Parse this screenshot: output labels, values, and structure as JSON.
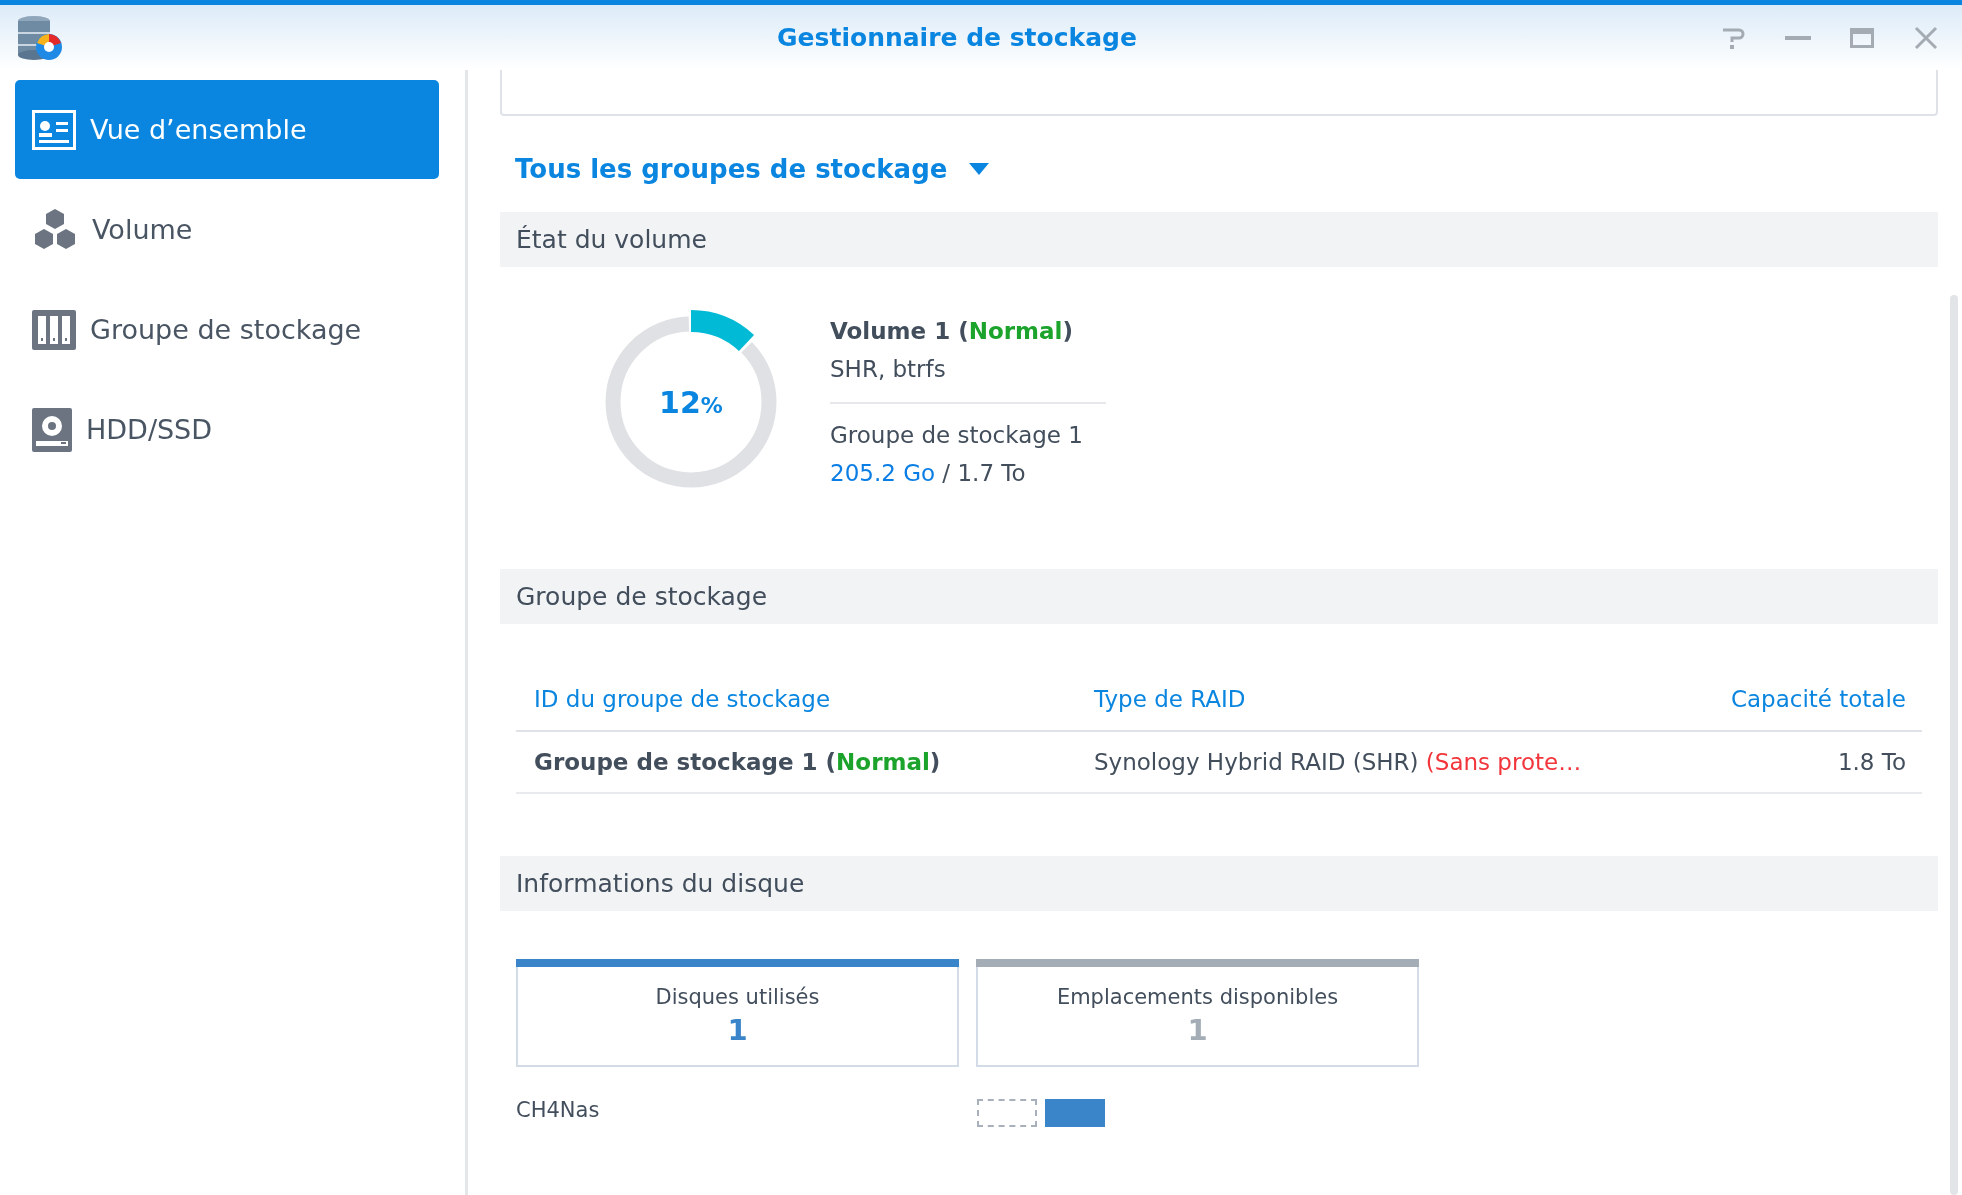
{
  "window": {
    "title": "Gestionnaire de stockage"
  },
  "sidebar": {
    "items": [
      {
        "label": "Vue d’ensemble",
        "kind": "overview",
        "selected": true
      },
      {
        "label": "Volume",
        "kind": "volume",
        "selected": false
      },
      {
        "label": "Groupe de stockage",
        "kind": "pool",
        "selected": false
      },
      {
        "label": "HDD/SSD",
        "kind": "disk",
        "selected": false
      }
    ]
  },
  "pool_selector": {
    "label": "Tous les groupes de stockage"
  },
  "volume_status": {
    "heading": "État du volume",
    "usage": {
      "level": 0.12,
      "percent": "12",
      "unit": "%"
    },
    "title_parts": [
      {
        "text": "Volume 1 ("
      },
      {
        "text": "Normal",
        "color": "#1ba32b"
      },
      {
        "text": ")"
      }
    ],
    "type": "SHR, btrfs",
    "pool": "Groupe de stockage 1",
    "capacity_parts": [
      {
        "text": "205.2 Go",
        "color": "#0a7ee4"
      },
      {
        "text": " / 1.7 To"
      }
    ]
  },
  "storage_pools": {
    "heading": "Groupe de stockage",
    "columns": [
      {
        "label": "ID du groupe de stockage"
      },
      {
        "label": "Type de RAID"
      },
      {
        "label": "Capacité totale"
      }
    ],
    "rows": [
      {
        "cells": [
          {
            "bold": true,
            "parts": [
              {
                "text": "Groupe de stockage 1 ("
              },
              {
                "text": "Normal",
                "color": "#1ba32b"
              },
              {
                "text": ")"
              }
            ]
          },
          {
            "bold": false,
            "parts": [
              {
                "text": "Synology Hybrid RAID (SHR) "
              },
              {
                "text": "(Sans prote…",
                "color": "#f2353b"
              }
            ]
          },
          {
            "bold": false,
            "parts": [
              {
                "text": "1.8 To"
              }
            ]
          }
        ]
      }
    ]
  },
  "disk_info": {
    "heading": "Informations du disque",
    "cards": [
      {
        "label": "Disques utilisés",
        "count": "1",
        "color": "#3a84c9"
      },
      {
        "label": "Emplacements disponibles",
        "count": "1",
        "color": "#a4adb6"
      }
    ],
    "host": "CH4Nas",
    "slots": [
      {
        "occupied": false
      },
      {
        "occupied": true
      }
    ]
  }
}
